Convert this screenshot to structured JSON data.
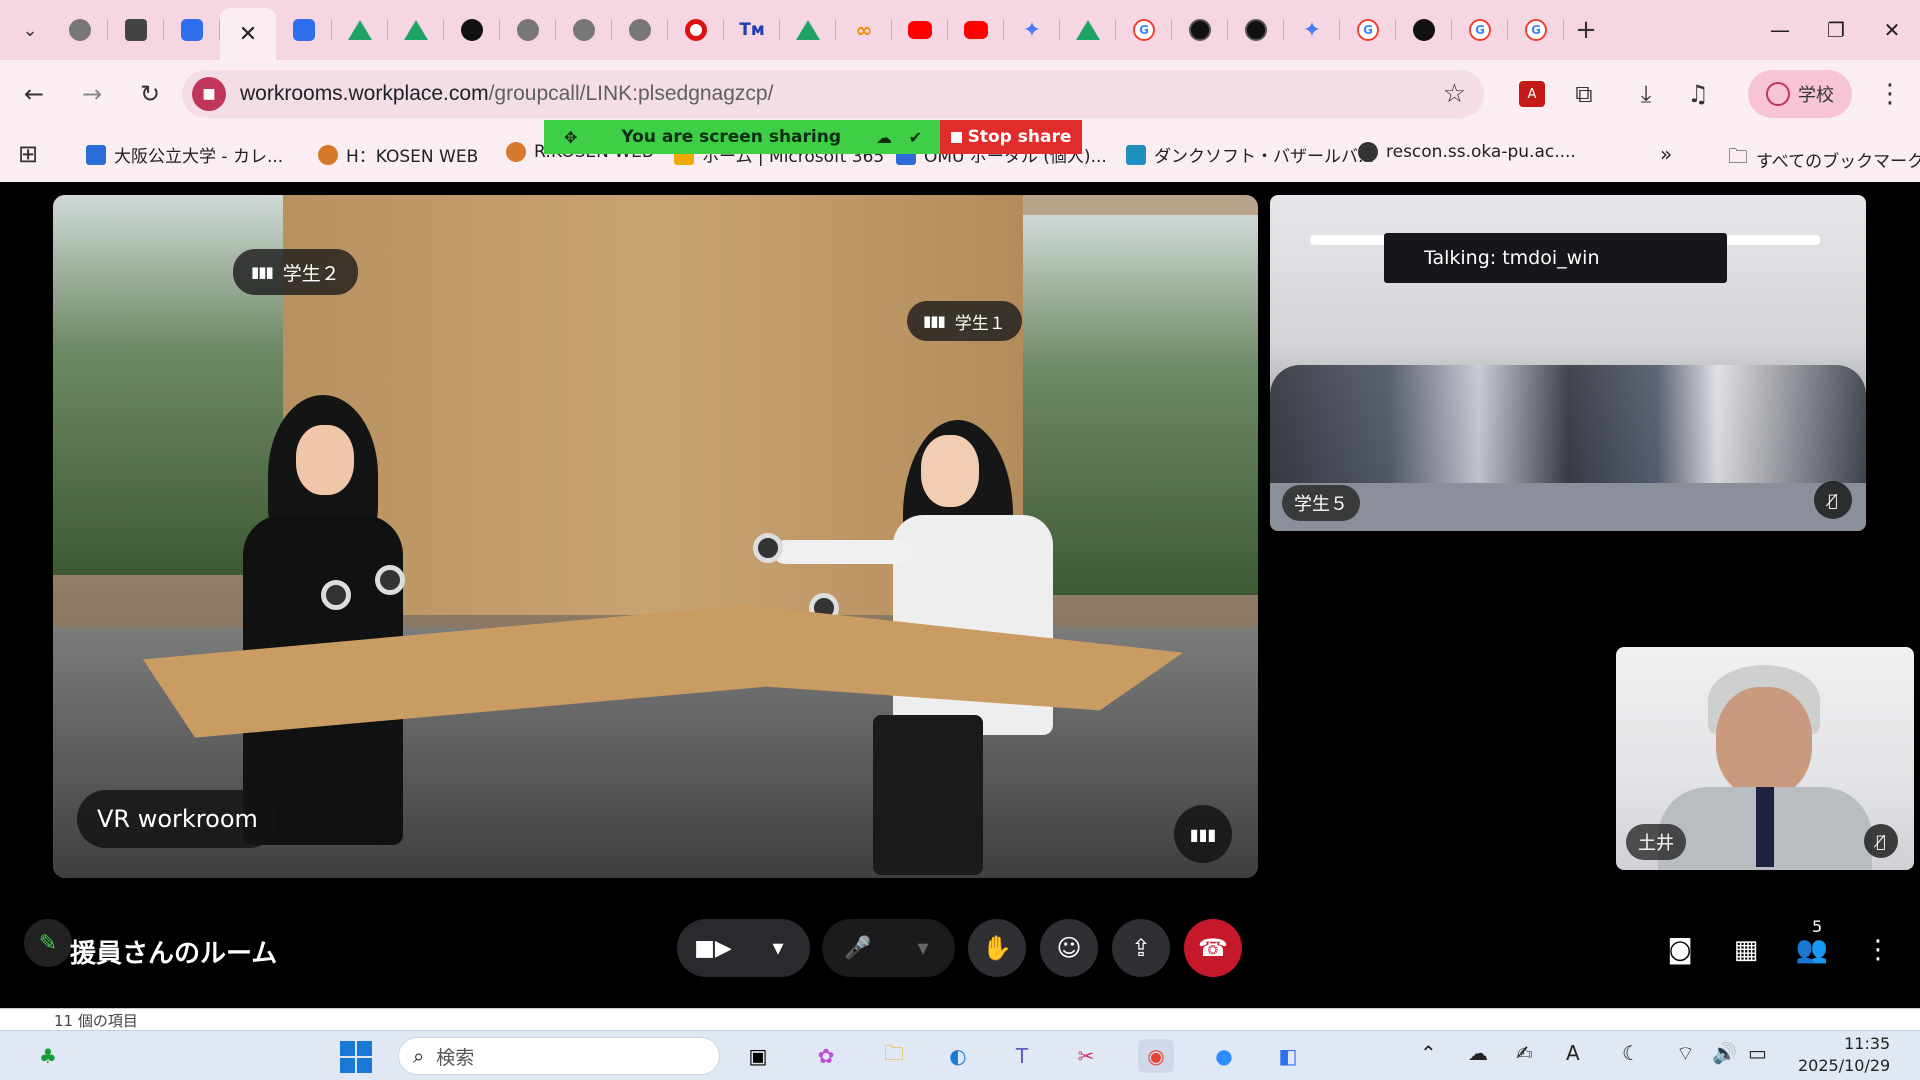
{
  "browser": {
    "tabs_count_note": "",
    "url_host": "workrooms.workplace.com",
    "url_path": "/groupcall/LINK:plsedgnagzcp/",
    "profile_label": "学校",
    "close_tab_glyph": "✕"
  },
  "bookmarks": [
    {
      "label": "大阪公立大学 - カレ...",
      "color": "#2b6cd6"
    },
    {
      "label": "H：KOSEN WEB",
      "color": "#d47a2a"
    },
    {
      "label": "R:KOSEN WEB",
      "color": "#d47a2a"
    },
    {
      "label": "ホーム | Microsoft 365",
      "color": "#f2a900"
    },
    {
      "label": "OMU ポータル (個人)...",
      "color": "#2b6cd6"
    },
    {
      "label": "ダンクソフト・バザールバ...",
      "color": "#1f8fbf"
    },
    {
      "label": "rescon.ss.oka-pu.ac....",
      "color": "#333333"
    }
  ],
  "bookmarks_all": "すべてのブックマーク",
  "share": {
    "message": "You are screen sharing",
    "stop_label": "Stop share"
  },
  "main_tile": {
    "label": "VR workroom",
    "avatar_labels": [
      "学生２",
      "学生１"
    ]
  },
  "camera_tile": {
    "talking": "Talking: tmdoi_win",
    "name": "学生５"
  },
  "self_tile": {
    "name": "土井"
  },
  "room_name": "援員さんのルーム",
  "participants_count": "5",
  "explorer_status": "11 個の項目",
  "taskbar": {
    "search_placeholder": "検索",
    "time": "11:35",
    "date": "2025/10/29"
  }
}
